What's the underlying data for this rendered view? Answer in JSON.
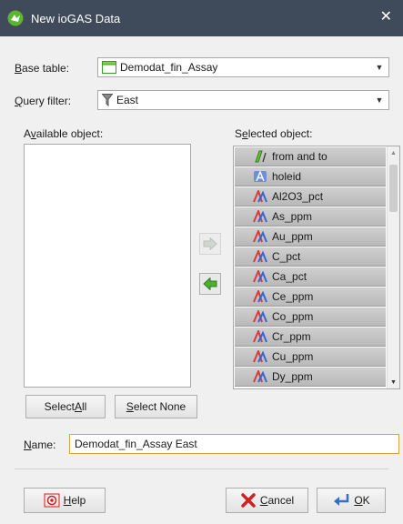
{
  "window": {
    "title": "New ioGAS Data",
    "close_glyph": "✕"
  },
  "base_table": {
    "label_underlined": "B",
    "label_rest": "ase table:",
    "value": "Demodat_fin_Assay",
    "icon": "table-icon"
  },
  "query_filter": {
    "label_underlined": "Q",
    "label_rest": "uery filter:",
    "value": "East",
    "icon": "filter-icon"
  },
  "available": {
    "label_pre": "A",
    "label_underlined": "v",
    "label_rest": "ailable object:",
    "items": []
  },
  "selected": {
    "label_pre": "S",
    "label_underlined": "e",
    "label_rest": "lected object:",
    "items": [
      {
        "label": "from and to",
        "icon": "interval-icon"
      },
      {
        "label": "holeid",
        "icon": "text-attribute-icon"
      },
      {
        "label": "Al2O3_pct",
        "icon": "numeric-attribute-icon"
      },
      {
        "label": "As_ppm",
        "icon": "numeric-attribute-icon"
      },
      {
        "label": "Au_ppm",
        "icon": "numeric-attribute-icon"
      },
      {
        "label": "C_pct",
        "icon": "numeric-attribute-icon"
      },
      {
        "label": "Ca_pct",
        "icon": "numeric-attribute-icon"
      },
      {
        "label": "Ce_ppm",
        "icon": "numeric-attribute-icon"
      },
      {
        "label": "Co_ppm",
        "icon": "numeric-attribute-icon"
      },
      {
        "label": "Cr_ppm",
        "icon": "numeric-attribute-icon"
      },
      {
        "label": "Cu_ppm",
        "icon": "numeric-attribute-icon"
      },
      {
        "label": "Dy_ppm",
        "icon": "numeric-attribute-icon"
      }
    ]
  },
  "buttons": {
    "select_all_pre": "Select ",
    "select_all_underlined": "A",
    "select_all_rest": "ll",
    "select_none_pre": "",
    "select_none_underlined": "S",
    "select_none_rest": "elect None",
    "help_underlined": "H",
    "help_rest": "elp",
    "cancel_underlined": "C",
    "cancel_rest": "ancel",
    "ok_underlined": "O",
    "ok_rest": "K"
  },
  "name_field": {
    "label_underlined": "N",
    "label_rest": "ame:",
    "value": "Demodat_fin_Assay East"
  },
  "colors": {
    "titlebar": "#3f4b5b",
    "focus_border": "#e0a13a",
    "arrow_green": "#4caf32",
    "selected_row": "#c4c4c4"
  }
}
